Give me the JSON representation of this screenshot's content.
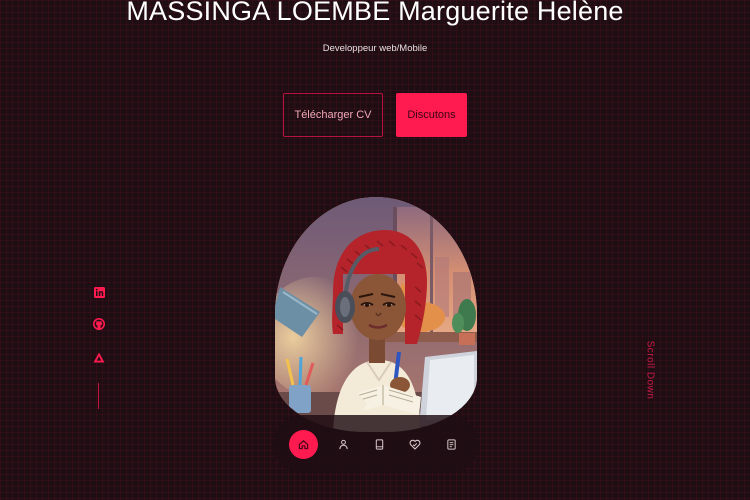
{
  "hero": {
    "name": "MASSINGA LOEMBE Marguerite Helène",
    "role": "Developpeur web/Mobile"
  },
  "buttons": {
    "download_cv": "Télécharger CV",
    "contact": "Discutons"
  },
  "socials": [
    {
      "icon": "linkedin-icon"
    },
    {
      "icon": "github-icon"
    },
    {
      "icon": "triangle-icon"
    }
  ],
  "scroll_label": "Scroll Down",
  "nav": [
    {
      "icon": "home-icon",
      "active": true
    },
    {
      "icon": "user-icon",
      "active": false
    },
    {
      "icon": "book-icon",
      "active": false
    },
    {
      "icon": "heart-icon",
      "active": false
    },
    {
      "icon": "document-icon",
      "active": false
    }
  ],
  "colors": {
    "accent": "#ff1a4f",
    "background": "#1e0d12",
    "outline": "#b6143f"
  }
}
